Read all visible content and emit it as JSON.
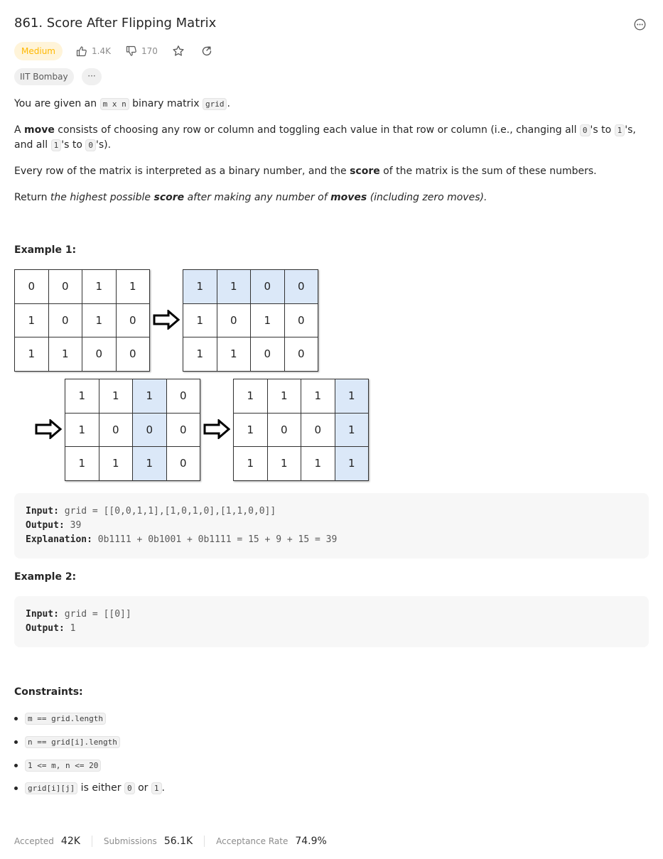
{
  "problem": {
    "title": "861. Score After Flipping Matrix",
    "difficulty": "Medium",
    "likes": "1.4K",
    "dislikes": "170",
    "company_tag": "IIT Bombay",
    "more_tags": "···"
  },
  "description": {
    "p1_pre": "You are given an ",
    "p1_code1": "m x n",
    "p1_mid": " binary matrix ",
    "p1_code2": "grid",
    "p1_end": ".",
    "p2_pre": "A ",
    "p2_bold": "move",
    "p2_mid1": " consists of choosing any row or column and toggling each value in that row or column (i.e., changing all ",
    "p2_code1": "0",
    "p2_mid2": "'s to ",
    "p2_code2": "1",
    "p2_mid3": "'s, and all ",
    "p2_code3": "1",
    "p2_mid4": "'s to ",
    "p2_code4": "0",
    "p2_end": "'s).",
    "p3_pre": "Every row of the matrix is interpreted as a binary number, and the ",
    "p3_bold": "score",
    "p3_end": " of the matrix is the sum of these numbers.",
    "p4_pre": "Return ",
    "p4_it1": "the highest possible ",
    "p4_bold1": "score",
    "p4_it2": " after making any number of ",
    "p4_bold2": "moves",
    "p4_it3": " (including zero moves)."
  },
  "example1": {
    "heading": "Example 1:",
    "grids": [
      [
        [
          "0",
          "0",
          "1",
          "1"
        ],
        [
          "1",
          "0",
          "1",
          "0"
        ],
        [
          "1",
          "1",
          "0",
          "0"
        ]
      ],
      [
        [
          "1",
          "1",
          "0",
          "0"
        ],
        [
          "1",
          "0",
          "1",
          "0"
        ],
        [
          "1",
          "1",
          "0",
          "0"
        ]
      ],
      [
        [
          "1",
          "1",
          "1",
          "0"
        ],
        [
          "1",
          "0",
          "0",
          "0"
        ],
        [
          "1",
          "1",
          "1",
          "0"
        ]
      ],
      [
        [
          "1",
          "1",
          "1",
          "1"
        ],
        [
          "1",
          "0",
          "0",
          "1"
        ],
        [
          "1",
          "1",
          "1",
          "1"
        ]
      ]
    ],
    "input_label": "Input:",
    "input_value": " grid = [[0,0,1,1],[1,0,1,0],[1,1,0,0]]",
    "output_label": "Output:",
    "output_value": " 39",
    "explanation_label": "Explanation:",
    "explanation_value": " 0b1111 + 0b1001 + 0b1111 = 15 + 9 + 15 = 39"
  },
  "example2": {
    "heading": "Example 2:",
    "input_label": "Input:",
    "input_value": " grid = [[0]]",
    "output_label": "Output:",
    "output_value": " 1"
  },
  "constraints": {
    "heading": "Constraints:",
    "c1": "m == grid.length",
    "c2": "n == grid[i].length",
    "c3": "1 <= m, n <= 20",
    "c4_code": "grid[i][j]",
    "c4_mid": " is either ",
    "c4_code2": "0",
    "c4_or": " or ",
    "c4_code3": "1",
    "c4_end": "."
  },
  "stats": {
    "accepted_label": "Accepted",
    "accepted_value": "42K",
    "submissions_label": "Submissions",
    "submissions_value": "56.1K",
    "rate_label": "Acceptance Rate",
    "rate_value": "74.9%"
  },
  "colors": {
    "highlight": "#dbe8f8",
    "medium": "#ffb800"
  }
}
